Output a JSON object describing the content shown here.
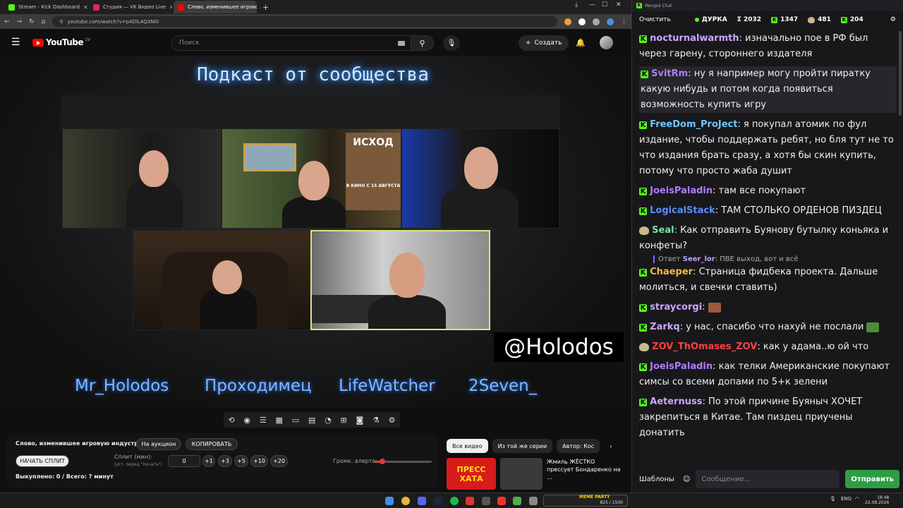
{
  "browser": {
    "tabs": [
      {
        "title": "Stream - Kick Dashboard",
        "color": "#53fc18"
      },
      {
        "title": "Студия — VK Видео Live",
        "color": "#e0245e"
      },
      {
        "title": "Слово, изменившее игрово",
        "color": "#ff0000",
        "active": true
      }
    ],
    "url": "youtube.com/watch?v=p4DlL4QXNl0"
  },
  "youtube": {
    "logo": "YouTube",
    "country": "LV",
    "search_placeholder": "Поиск",
    "create_label": "Создать"
  },
  "video": {
    "title": "Подкаст от сообщества",
    "handle": "@Holodos",
    "names": [
      "Mr_Holodos",
      "Проходимец",
      "LifeWatcher",
      "2Seven_"
    ],
    "poster_text": "ИСХОД",
    "poster_sub": "В КИНО С 15 АВГУСТА"
  },
  "extension": {
    "title": "Слово, изменившее игровую индустрию",
    "auction_btn": "На аукцион",
    "copy_btn": "КОПИРОВАТЬ",
    "start_split_btn": "НАЧАТЬ СПЛИТ",
    "split_label": "Сплит (мин):",
    "split_hint": "(уст. перед \"Начать\")",
    "split_value": "0",
    "increments": [
      "+1",
      "+3",
      "+5",
      "+10",
      "+20"
    ],
    "alert_volume_label": "Громк. алерта:",
    "alert_volume": 0.12,
    "paid_status": "Выкуплено: 0 / Всего: ? минут"
  },
  "recommendations": {
    "chips": [
      "Все видео",
      "Из той же серии",
      "Автор: Кос"
    ],
    "items": [
      {
        "thumb_text": "ПРЕСС ХАТА",
        "title": "Жмиль ЖЁСТКО прессует Бондаренко на ..."
      }
    ]
  },
  "chat": {
    "window_title": "Merged Chat",
    "clear_label": "Очистить",
    "stats": [
      {
        "icon": "dot",
        "value": "ДУРКА"
      },
      {
        "icon": "sigma",
        "value": "Σ 2032"
      },
      {
        "icon": "kick",
        "value": "1347"
      },
      {
        "icon": "mod",
        "value": "481"
      },
      {
        "icon": "kick",
        "value": "204"
      }
    ],
    "messages": [
      {
        "user": "nocturnalwarmth",
        "color": "#c9a7ff",
        "badge": "kick",
        "text": "изначально пое в РФ был через гарену, стороннего издателя"
      },
      {
        "user": "SvitRm",
        "color": "#b07bff",
        "badge": "kick",
        "text": "ну я например могу пройти пиратку какую нибудь и потом когда появиться возможность купить игру",
        "highlight": true
      },
      {
        "user": "FreeDom_ProJect",
        "color": "#6fc6ff",
        "badge": "kick",
        "text": "я покупал атомик по фул издание, чтобы поддержать ребят, но бля тут не то что издания брать сразу, а хотя бы скин купить, потому что просто жаба душит"
      },
      {
        "user": "JoeisPaladin",
        "color": "#b07bff",
        "badge": "kick",
        "text": "там все покупают"
      },
      {
        "user": "LogicalStack",
        "color": "#5a8cff",
        "badge": "kick",
        "text": "ТАМ СТОЛЬКО ОРДЕНОВ ПИЗДЕЦ"
      },
      {
        "user": "Seal",
        "color": "#7be0a6",
        "badge": "mod",
        "text": "Как отправить Буянову бутылку коньяка и конфеты?"
      },
      {
        "reply": true,
        "reply_prefix": "Ответ",
        "reply_user": "Seer_lor",
        "reply_text": "ПВЕ выход, вот и всё"
      },
      {
        "user": "Chaeper",
        "color": "#ffb347",
        "badge": "kick",
        "text": "Страница фидбека проекта. Дальше молиться, и свечки ставить)"
      },
      {
        "user": "straycorgi",
        "color": "#c9a7ff",
        "badge": "kick",
        "text": "",
        "emote": "brown"
      },
      {
        "user": "Zarkq",
        "color": "#c9a7ff",
        "badge": "kick",
        "text": "у нас, спасибо что нахуй не послали",
        "emote": "frog"
      },
      {
        "user": "ZOV_ThOmases_ZOV",
        "color": "#ff4040",
        "badge": "mod",
        "text": "как у адама..ю ой что"
      },
      {
        "user": "JoeisPaladin",
        "color": "#b07bff",
        "badge": "kick",
        "text": "как телки Американские покупают симсы со всеми допами по 5+к зелени"
      },
      {
        "user": "Aeternuss",
        "color": "#c9a7ff",
        "badge": "kick",
        "text": "По этой причине Буяныч ХОЧЕТ закрепиться в Китае. Там пиздец приучены донатить"
      }
    ],
    "templates_label": "Шаблоны",
    "input_placeholder": "Сообщение...",
    "send_label": "Отправить"
  },
  "taskbar": {
    "meme_party": "MEME PARTY",
    "meme_counter": "825 / 1500",
    "lang": "ENG",
    "time": "18:48",
    "date": "22.08.2026"
  }
}
